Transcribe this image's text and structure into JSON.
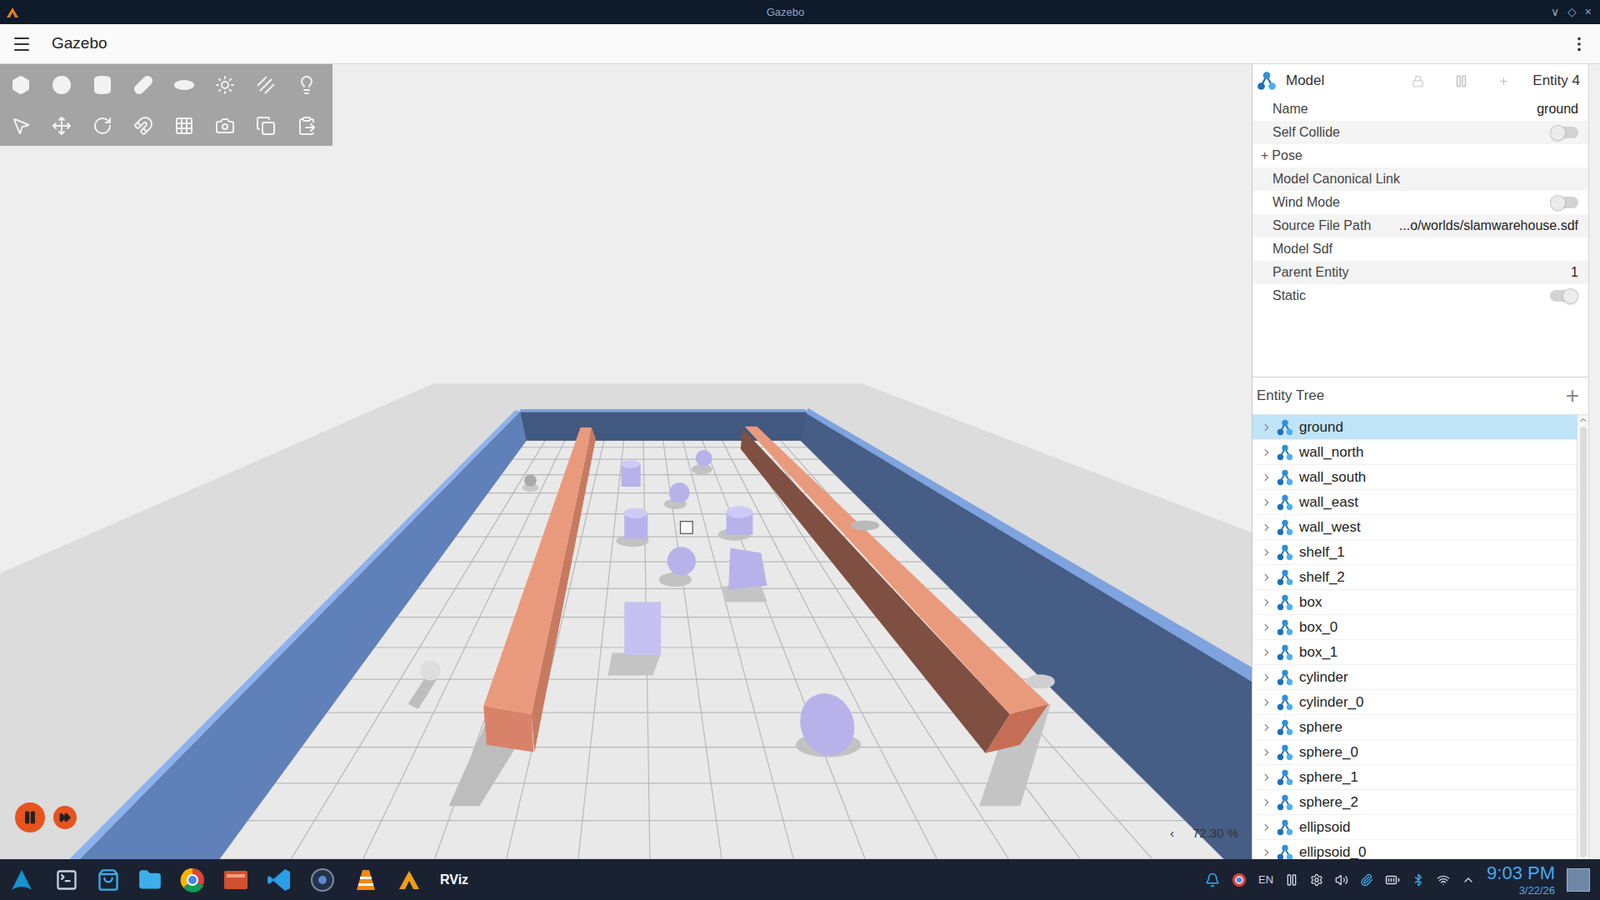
{
  "window": {
    "title": "Gazebo",
    "controls": [
      "∨",
      "◇",
      "×"
    ]
  },
  "header": {
    "title": "Gazebo"
  },
  "viewport": {
    "zoom_arrow": "‹",
    "zoom": "72.30 %",
    "playing": true
  },
  "inspector": {
    "title": "Model",
    "entity": "Entity 4",
    "rows": [
      {
        "kind": "text",
        "label": "Name",
        "value": "ground"
      },
      {
        "kind": "toggle",
        "label": "Self Collide",
        "on": false
      },
      {
        "kind": "expand",
        "label": "Pose",
        "marker": "+"
      },
      {
        "kind": "label",
        "label": "Model Canonical Link"
      },
      {
        "kind": "toggle",
        "label": "Wind Mode",
        "on": false
      },
      {
        "kind": "text",
        "label": "Source File Path",
        "value": "...o/worlds/slamwarehouse.sdf"
      },
      {
        "kind": "label",
        "label": "Model Sdf"
      },
      {
        "kind": "text",
        "label": "Parent Entity",
        "value": "1"
      },
      {
        "kind": "toggle",
        "label": "Static",
        "on": true
      }
    ]
  },
  "entity_tree": {
    "title": "Entity Tree",
    "add": "+",
    "items": [
      {
        "name": "ground",
        "selected": true
      },
      {
        "name": "wall_north",
        "selected": false
      },
      {
        "name": "wall_south",
        "selected": false
      },
      {
        "name": "wall_east",
        "selected": false
      },
      {
        "name": "wall_west",
        "selected": false
      },
      {
        "name": "shelf_1",
        "selected": false
      },
      {
        "name": "shelf_2",
        "selected": false
      },
      {
        "name": "box",
        "selected": false
      },
      {
        "name": "box_0",
        "selected": false
      },
      {
        "name": "box_1",
        "selected": false
      },
      {
        "name": "cylinder",
        "selected": false
      },
      {
        "name": "cylinder_0",
        "selected": false
      },
      {
        "name": "sphere",
        "selected": false
      },
      {
        "name": "sphere_0",
        "selected": false
      },
      {
        "name": "sphere_1",
        "selected": false
      },
      {
        "name": "sphere_2",
        "selected": false
      },
      {
        "name": "ellipsoid",
        "selected": false
      },
      {
        "name": "ellipsoid_0",
        "selected": false
      }
    ]
  },
  "taskbar": {
    "rviz_label": "RViz",
    "language": "EN",
    "time": "9:03 PM",
    "date": "3/22/26"
  }
}
